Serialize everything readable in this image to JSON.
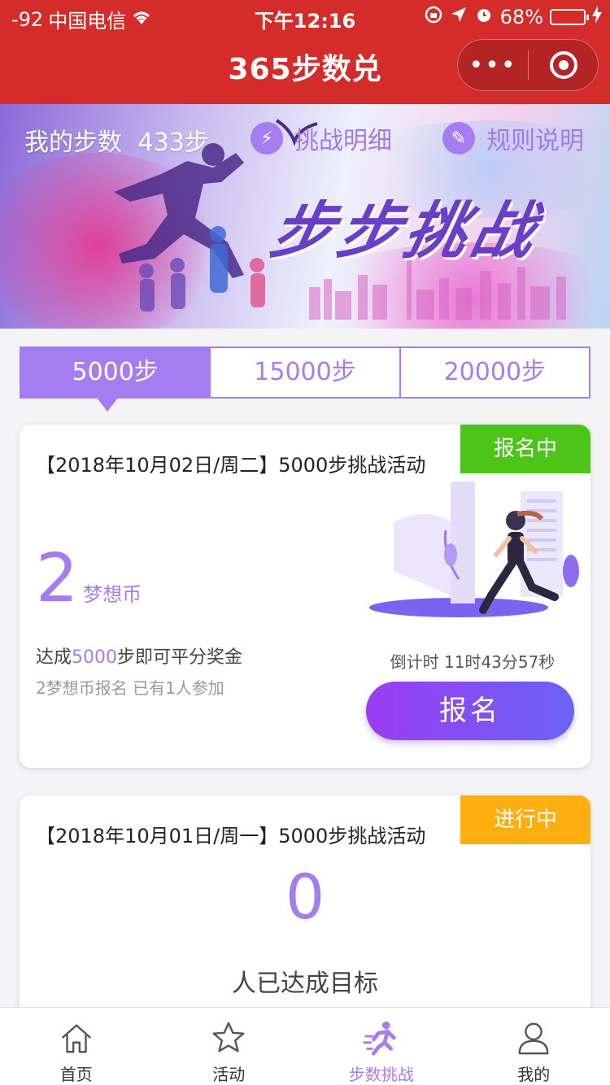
{
  "status_bar": {
    "signal": "-92",
    "carrier": "中国电信",
    "time": "下午12:16",
    "battery": "68%"
  },
  "nav": {
    "title": "365步数兑",
    "more_icon": "more-dots-icon",
    "close_icon": "target-icon"
  },
  "banner": {
    "my_steps_label": "我的步数",
    "my_steps_value": "433步",
    "challenge_detail": "挑战明细",
    "rules": "规则说明",
    "headline": "步步挑战"
  },
  "tabs": [
    "5000步",
    "15000步",
    "20000步"
  ],
  "active_tab": 0,
  "cards": [
    {
      "status": "报名中",
      "status_color": "#4cc41a",
      "title": "【2018年10月02日/周二】5000步挑战活动",
      "coins": "2",
      "coins_unit": "梦想币",
      "desc_prefix": "达成",
      "desc_highlight": "5000",
      "desc_suffix": "步即可平分奖金",
      "sub_desc": "2梦想币报名 已有1人参加",
      "countdown": "倒计时 11时43分57秒",
      "button": "报名"
    },
    {
      "status": "进行中",
      "status_color": "#ffae0f",
      "title": "【2018年10月01日/周一】5000步挑战活动",
      "count": "0",
      "count_label": "人已达成目标"
    }
  ],
  "tabbar": [
    {
      "label": "首页",
      "icon": "home-icon"
    },
    {
      "label": "活动",
      "icon": "star-icon"
    },
    {
      "label": "步数挑战",
      "icon": "runner-icon"
    },
    {
      "label": "我的",
      "icon": "user-icon"
    }
  ],
  "colors": {
    "nav_red": "#d42b2b",
    "accent_purple": "#a57df0"
  }
}
